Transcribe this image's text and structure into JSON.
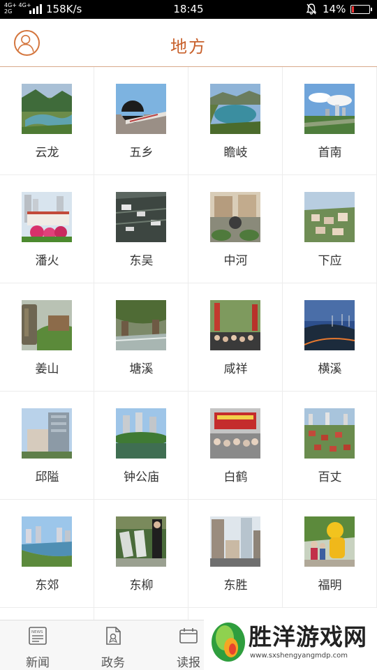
{
  "status_bar": {
    "network": [
      "4G+ 4G+",
      "2G"
    ],
    "speed": "158K/s",
    "time": "18:45",
    "battery": "14%",
    "battery_level": 0.14
  },
  "header": {
    "title": "地方",
    "avatar_icon": "user-icon"
  },
  "accent_color": "#c8602b",
  "places": [
    {
      "label": "云龙",
      "icon": "mountain-lake-photo"
    },
    {
      "label": "五乡",
      "icon": "bridge-photo"
    },
    {
      "label": "瞻岐",
      "icon": "reservoir-photo"
    },
    {
      "label": "首南",
      "icon": "city-skyline-photo"
    },
    {
      "label": "潘火",
      "icon": "building-flowers-photo"
    },
    {
      "label": "东吴",
      "icon": "village-roofs-photo"
    },
    {
      "label": "中河",
      "icon": "plaza-statue-photo"
    },
    {
      "label": "下应",
      "icon": "town-aerial-photo"
    },
    {
      "label": "姜山",
      "icon": "stone-monument-photo"
    },
    {
      "label": "塘溪",
      "icon": "stream-photo"
    },
    {
      "label": "咸祥",
      "icon": "festival-crowd-photo"
    },
    {
      "label": "横溪",
      "icon": "sunset-hills-photo"
    },
    {
      "label": "邱隘",
      "icon": "office-building-photo"
    },
    {
      "label": "钟公庙",
      "icon": "park-towers-photo"
    },
    {
      "label": "白鹤",
      "icon": "stage-crowd-photo"
    },
    {
      "label": "百丈",
      "icon": "city-aerial-photo"
    },
    {
      "label": "东郊",
      "icon": "river-city-photo"
    },
    {
      "label": "东柳",
      "icon": "exhibition-photo"
    },
    {
      "label": "东胜",
      "icon": "street-towers-photo"
    },
    {
      "label": "福明",
      "icon": "lion-dance-photo"
    }
  ],
  "bottom_nav": [
    {
      "label": "新闻",
      "icon": "newspaper-icon",
      "badge": "NEWS"
    },
    {
      "label": "政务",
      "icon": "document-icon"
    },
    {
      "label": "读报",
      "icon": "reader-icon"
    }
  ],
  "watermark": {
    "text": "胜洋游戏网",
    "url": "www.sxshengyangmdp.com"
  }
}
